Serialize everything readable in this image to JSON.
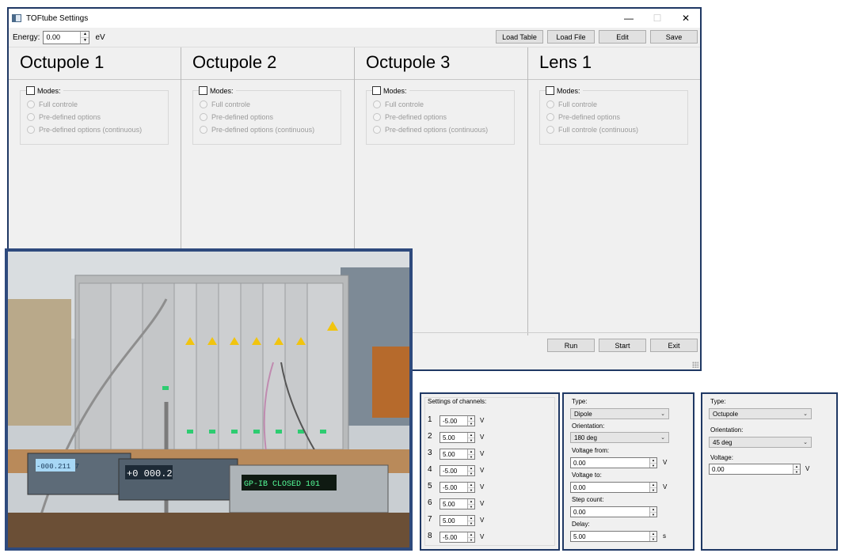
{
  "window": {
    "title": "TOFtube Settings",
    "controls": {
      "minimize": "—",
      "maximize": "☐",
      "close": "✕"
    }
  },
  "toolbar": {
    "energy_label": "Energy:",
    "energy_value": "0.00",
    "energy_unit": "eV",
    "buttons": [
      "Load Table",
      "Load File",
      "Edit",
      "Save"
    ]
  },
  "columns": [
    {
      "title": "Octupole 1",
      "group_label": "Modes:",
      "options": [
        "Full controle",
        "Pre-defined options",
        "Pre-defined options (continuous)"
      ]
    },
    {
      "title": "Octupole 2",
      "group_label": "Modes:",
      "options": [
        "Full controle",
        "Pre-defined options",
        "Pre-defined options (continuous)"
      ]
    },
    {
      "title": "Octupole 3",
      "group_label": "Modes:",
      "options": [
        "Full controle",
        "Pre-defined options",
        "Pre-defined options (continuous)"
      ]
    },
    {
      "title": "Lens 1",
      "group_label": "Modes:",
      "options": [
        "Full controle",
        "Pre-defined options",
        "Full controle (continuous)"
      ]
    }
  ],
  "bottom_buttons": [
    "Run",
    "Start",
    "Exit"
  ],
  "photo_display": {
    "meter_left": "-000.211 7",
    "meter_mid": "+0 000.2",
    "display_text": "GP-IB CLOSED 101"
  },
  "panel_channels": {
    "title": "Settings of channels:",
    "unit": "V",
    "channels": [
      {
        "index": "1",
        "value": "-5.00"
      },
      {
        "index": "2",
        "value": "5.00"
      },
      {
        "index": "3",
        "value": "5.00"
      },
      {
        "index": "4",
        "value": "-5.00"
      },
      {
        "index": "5",
        "value": "-5.00"
      },
      {
        "index": "6",
        "value": "5.00"
      },
      {
        "index": "7",
        "value": "5.00"
      },
      {
        "index": "8",
        "value": "-5.00"
      }
    ]
  },
  "panel_dipole": {
    "type_label": "Type:",
    "type_value": "Dipole",
    "orientation_label": "Orientation:",
    "orientation_value": "180 deg",
    "voltage_from_label": "Voltage from:",
    "voltage_from_value": "0.00",
    "voltage_to_label": "Voltage to:",
    "voltage_to_value": "0.00",
    "step_count_label": "Step count:",
    "step_count_value": "0.00",
    "delay_label": "Delay:",
    "delay_value": "5.00",
    "volt_unit": "V",
    "time_unit": "s"
  },
  "panel_octupole": {
    "type_label": "Type:",
    "type_value": "Octupole",
    "orientation_label": "Orientation:",
    "orientation_value": "45 deg",
    "voltage_label": "Voltage:",
    "voltage_value": "0.00",
    "volt_unit": "V"
  }
}
